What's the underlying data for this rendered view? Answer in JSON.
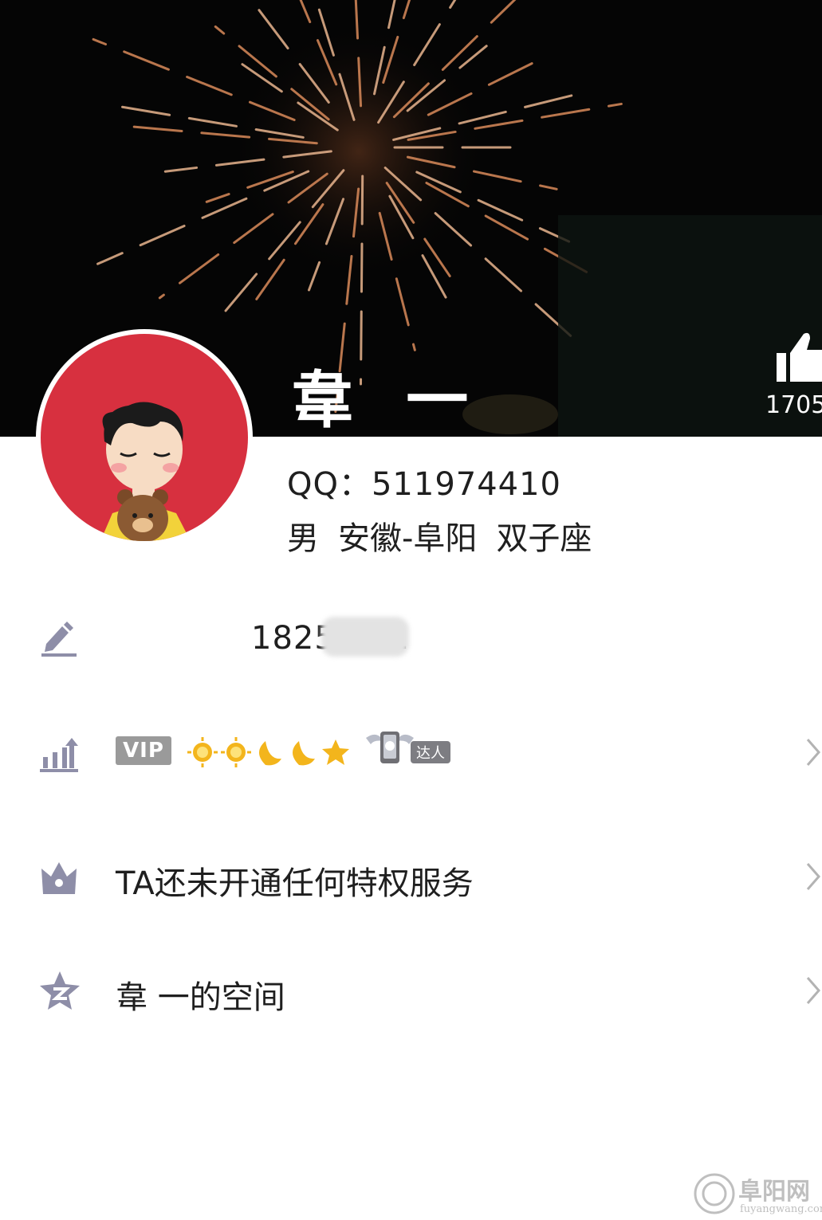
{
  "profile": {
    "name": "韋  一",
    "likes": "1705",
    "qq": "QQ：511974410",
    "gender": "男",
    "location": "安徽-阜阳",
    "zodiac": "双子座"
  },
  "rows": {
    "signature": {
      "phone_visible": "1825      761",
      "icon": "pencil-icon"
    },
    "level": {
      "vip_label": "VIP",
      "daren_label": "达人",
      "icon": "bar-chart-up-icon"
    },
    "privilege": {
      "text": "TA还未开通任何特权服务",
      "icon": "crown-icon"
    },
    "space": {
      "text": "韋  一的空间",
      "icon": "qzone-star-icon"
    }
  },
  "watermark": {
    "text": "阜阳网",
    "sub": "fuyangwang.com"
  },
  "colors": {
    "avatar_bg": "#d7303f",
    "icon_gray": "#8e8ea8",
    "cover_bg": "#050505"
  }
}
